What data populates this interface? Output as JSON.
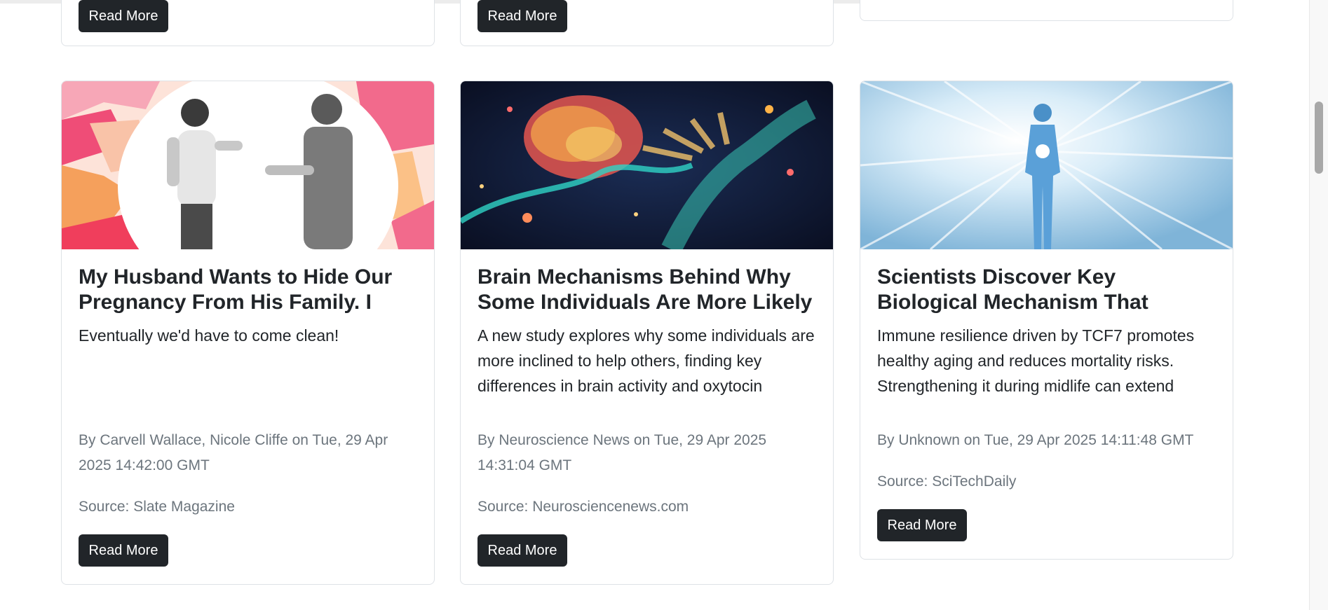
{
  "top_row": {
    "cards": [
      {
        "button": "Read More"
      },
      {
        "button": "Read More"
      },
      {}
    ]
  },
  "articles": [
    {
      "image": "couple-arguing-illustration",
      "title": "My Husband Wants to Hide Our Pregnancy From His Family. I Can’t",
      "description": "Eventually we'd have to come clean!",
      "byline": "By Carvell Wallace, Nicole Cliffe on Tue, 29 Apr 2025 14:42:00 GMT",
      "source": "Source: Slate Magazine",
      "button": "Read More"
    },
    {
      "image": "glowing-brain-and-hand-illustration",
      "title": "Brain Mechanisms Behind Why Some Individuals Are More Likely",
      "description": "A new study explores why some individuals are more inclined to help others, finding key differences in brain activity and oxytocin signaling.",
      "byline": "By Neuroscience News on Tue, 29 Apr 2025 14:31:04 GMT",
      "source": "Source: Neurosciencenews.com",
      "button": "Read More"
    },
    {
      "image": "glowing-human-figure-light-rays",
      "title": "Scientists Discover Key Biological Mechanism That Promotes Healthy",
      "description": "Immune resilience driven by TCF7 promotes healthy aging and reduces mortality risks. Strengthening it during midlife can extend healthy aging by slowing its effect thereof",
      "byline": "By Unknown on Tue, 29 Apr 2025 14:11:48 GMT",
      "source": "Source: SciTechDaily",
      "button": "Read More"
    }
  ],
  "colors": {
    "button_bg": "#212529",
    "muted_text": "#6c757d",
    "border": "#dee2e6"
  }
}
